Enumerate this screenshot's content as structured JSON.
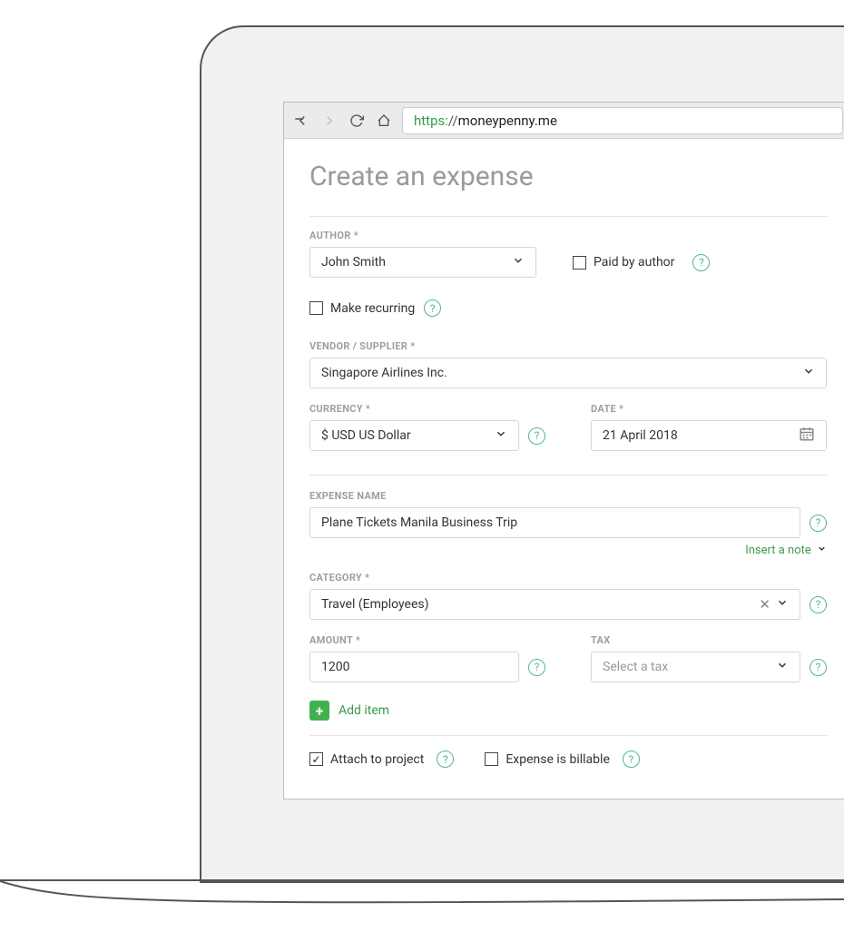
{
  "browser": {
    "url_protocol": "https:",
    "url_sep": "//",
    "url_host": "moneypenny.me"
  },
  "page": {
    "title": "Create an expense",
    "labels": {
      "author": "AUTHOR *",
      "paid_by_author": "Paid by author",
      "make_recurring": "Make recurring",
      "vendor": "VENDOR / SUPPLIER *",
      "currency": "CURRENCY *",
      "date": "DATE *",
      "expense_name": "EXPENSE NAME",
      "insert_note": "Insert a note",
      "category": "CATEGORY *",
      "amount": "AMOUNT *",
      "tax": "TAX",
      "add_item": "Add item",
      "attach_to_project": "Attach to project",
      "expense_billable": "Expense is billable"
    },
    "values": {
      "author": "John Smith",
      "vendor": "Singapore Airlines Inc.",
      "currency": "$ USD US Dollar",
      "date": "21 April 2018",
      "expense_name": "Plane Tickets Manila Business Trip",
      "category": "Travel (Employees)",
      "amount": "1200",
      "tax_placeholder": "Select a tax"
    },
    "checks": {
      "paid_by_author": false,
      "make_recurring": false,
      "attach_to_project": true,
      "expense_billable": false
    }
  }
}
